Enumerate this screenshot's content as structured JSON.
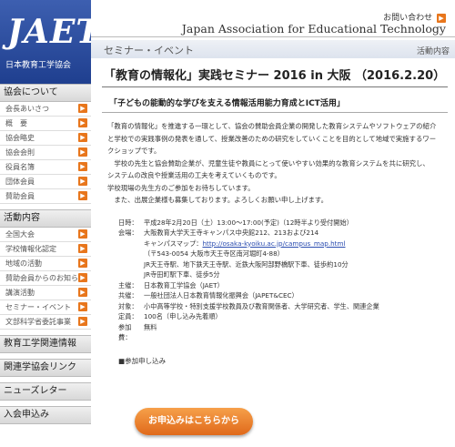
{
  "header": {
    "logo": "JAET",
    "logo_sub": "日本教育工学協会",
    "contact": "お問い合わせ",
    "association": "Japan Association for Educational Technology",
    "section": "セミナー・イベント",
    "section_right": "活動内容",
    "accent": "#e8761c",
    "brand": "#1f3f8f"
  },
  "sidebar": {
    "groups": [
      {
        "title": "協会について",
        "items": [
          "会長あいさつ",
          "概　要",
          "協会略史",
          "協会会則",
          "役員名簿",
          "団体会員",
          "賛助会員"
        ]
      },
      {
        "title": "活動内容",
        "items": [
          "全国大会",
          "学校情報化認定",
          "地域の活動",
          "賛助会員からのお知らせ",
          "講演活動",
          "セミナー・イベント",
          "文部科学省委託事業"
        ]
      },
      {
        "title": "教育工学関連情報",
        "items": []
      },
      {
        "title": "関連学協会リンク",
        "items": []
      },
      {
        "title": "ニューズレター",
        "items": []
      },
      {
        "title": "入会申込み",
        "items": []
      }
    ]
  },
  "main": {
    "title": "「教育の情報化」実践セミナー 2016 in 大阪 （2016.2.20）",
    "subtitle": "「子どもの能動的な学びを支える情報活用能力育成とICT活用」",
    "body": [
      "「教育の情報化」を推進する一環として、協会の賛助会員企業の開発した教育システムやソフトウェアの紹介",
      "と学校での実践事例の発表を通して、授業改善のための研究をしていくことを目的として地域で実施するワー",
      "クショップです。",
      "　学校の先生と協会賛助企業が、児童生徒や教員にとって使いやすい効果的な教育システムを共に研究し、",
      "システムの改良や授業活用の工夫を考えていくものです。",
      "学校現場の先生方のご参加をお待ちしています。",
      "　また、出展企業様も募集しております。よろしくお願い申し上げます。"
    ],
    "details": [
      {
        "k": "日時：",
        "v": [
          "平成28年2月20日（土）13:00～17:00(予定)（12時半より受付開始）"
        ]
      },
      {
        "k": "会場：",
        "v": [
          "大阪教育大学天王寺キャンパス中央館212、213および214",
          "キャンパスマップ：",
          "（〒543-0054  大阪市天王寺区南河堀町4-88）",
          "JR天王寺駅、地下鉄天王寺駅、近鉄大阪阿部野橋駅下車、徒歩約10分",
          "JR寺田町駅下車、徒歩5分"
        ]
      },
      {
        "k": "主催：",
        "v": [
          "日本教育工学協会（JAET）"
        ]
      },
      {
        "k": "共催：",
        "v": [
          "一般社団法人日本教育情報化振興会（JAPET&CEC）"
        ]
      },
      {
        "k": "対象：",
        "v": [
          "小中高等学校・特別支援学校教員及び教育関係者、大学研究者、学生、関連企業"
        ]
      },
      {
        "k": "定員：",
        "v": [
          "100名（申し込み先着順）"
        ]
      },
      {
        "k": "参加費：",
        "v": [
          "無料"
        ]
      }
    ],
    "map_link": "http://osaka-kyoiku.ac.jp/campus_map.html",
    "apply_label": "■参加申し込み",
    "apply_button": "お申込みはこちらから"
  }
}
